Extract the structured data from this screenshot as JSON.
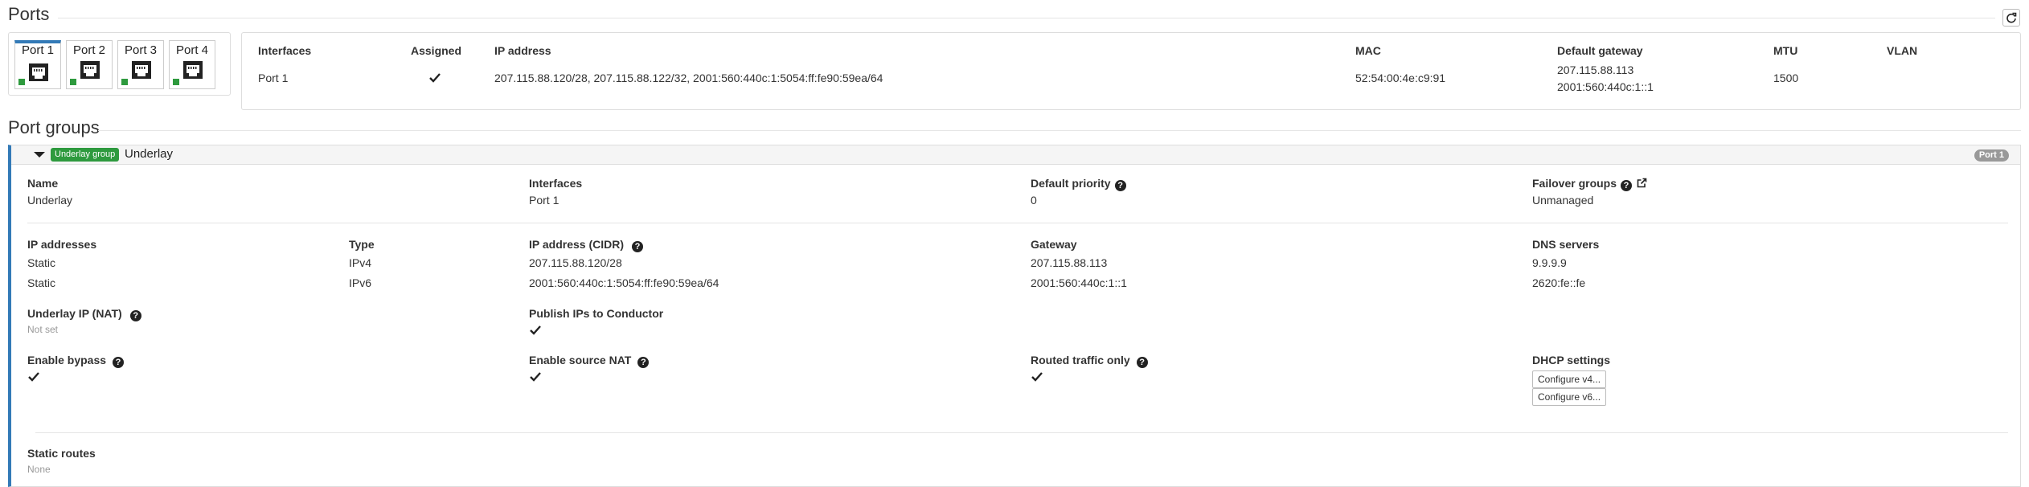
{
  "ports_section": {
    "title": "Ports",
    "tiles": [
      {
        "label": "Port 1",
        "active": true
      },
      {
        "label": "Port 2",
        "active": false
      },
      {
        "label": "Port 3",
        "active": false
      },
      {
        "label": "Port 4",
        "active": false
      }
    ],
    "table": {
      "headers": {
        "interfaces": "Interfaces",
        "assigned": "Assigned",
        "ip_address": "IP address",
        "mac": "MAC",
        "default_gateway": "Default gateway",
        "mtu": "MTU",
        "vlan": "VLAN"
      },
      "row": {
        "interfaces": "Port 1",
        "assigned": true,
        "ip_address": "207.115.88.120/28, 207.115.88.122/32, 2001:560:440c:1:5054:ff:fe90:59ea/64",
        "mac": "52:54:00:4e:c9:91",
        "default_gateway_v4": "207.115.88.113",
        "default_gateway_v6": "2001:560:440c:1::1",
        "mtu": "1500",
        "vlan": ""
      }
    }
  },
  "port_groups_section": {
    "title": "Port groups",
    "group": {
      "badge": "Underlay group",
      "name": "Underlay",
      "port_badge": "Port 1",
      "fields": {
        "name_label": "Name",
        "name_value": "Underlay",
        "interfaces_label": "Interfaces",
        "interfaces_value": "Port 1",
        "default_priority_label": "Default priority",
        "default_priority_value": "0",
        "failover_groups_label": "Failover groups",
        "failover_groups_value": "Unmanaged"
      },
      "ip_table": {
        "headers": {
          "ip_addresses": "IP addresses",
          "type": "Type",
          "cidr": "IP address (CIDR)",
          "gateway": "Gateway",
          "dns": "DNS servers"
        },
        "rows": [
          {
            "mode": "Static",
            "type": "IPv4",
            "cidr": "207.115.88.120/28",
            "gateway": "207.115.88.113",
            "dns": "9.9.9.9"
          },
          {
            "mode": "Static",
            "type": "IPv6",
            "cidr": "2001:560:440c:1:5054:ff:fe90:59ea/64",
            "gateway": "2001:560:440c:1::1",
            "dns": "2620:fe::fe"
          }
        ]
      },
      "underlay_ip_label": "Underlay IP (NAT)",
      "underlay_ip_value": "Not set",
      "publish_ips_label": "Publish IPs to Conductor",
      "publish_ips_value": true,
      "enable_bypass_label": "Enable bypass",
      "enable_bypass_value": true,
      "enable_source_nat_label": "Enable source NAT",
      "enable_source_nat_value": true,
      "routed_traffic_only_label": "Routed traffic only",
      "routed_traffic_only_value": true,
      "dhcp_settings_label": "DHCP settings",
      "configure_v4_label": "Configure v4...",
      "configure_v6_label": "Configure v6...",
      "static_routes_label": "Static routes",
      "static_routes_value": "None"
    }
  },
  "colors": {
    "accent": "#337ab7",
    "status_green": "#2e9a3e",
    "badge_grey": "#999999",
    "muted_text": "#999999"
  },
  "icons": {
    "refresh": "refresh-icon",
    "ethernet_port": "ethernet-port-icon",
    "check": "check-icon",
    "help": "question-circle-icon",
    "external_link": "external-link-icon",
    "caret": "caret-down-icon"
  }
}
